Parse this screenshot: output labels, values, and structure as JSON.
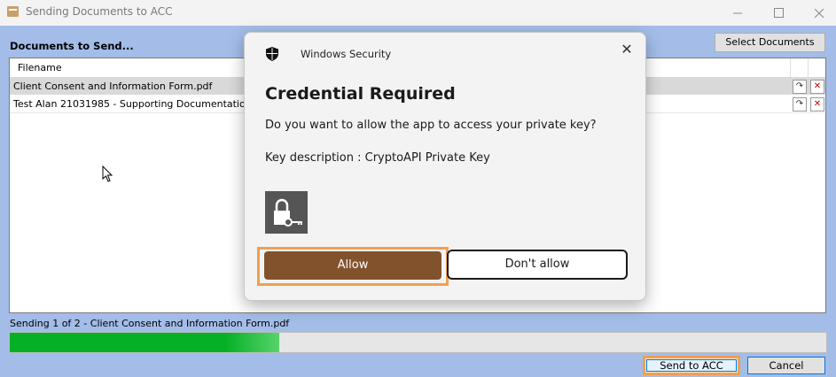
{
  "window": {
    "title": "Sending Documents to ACC",
    "minimize_icon": "minimize-icon",
    "maximize_icon": "maximize-icon",
    "close_icon": "close-icon"
  },
  "documents": {
    "label": "Documents to Send...",
    "select_button": "Select Documents",
    "column_header": "Filename",
    "rows": [
      {
        "filename": "Client Consent and Information Form.pdf",
        "selected": true
      },
      {
        "filename": "Test Alan 21031985 - Supporting Documentation.pdf",
        "selected": false
      }
    ],
    "row_actions": {
      "refresh_icon": "refresh-icon",
      "delete_icon": "delete-icon",
      "delete_glyph": "✕",
      "refresh_glyph": "↷"
    }
  },
  "status": {
    "text": "Sending 1 of 2 - Client Consent and Information Form.pdf",
    "progress_fraction": 0.33,
    "progress_color": "#06b025"
  },
  "footer": {
    "send_button": "Send to ACC",
    "cancel_button": "Cancel"
  },
  "dialog": {
    "app_name": "Windows Security",
    "title": "Credential Required",
    "question": "Do you want to allow the app to access your private key?",
    "key_description": "Key description  : CryptoAPI Private Key",
    "allow_button": "Allow",
    "deny_button": "Don't allow",
    "close_glyph": "✕",
    "accent_color": "#82522d"
  }
}
